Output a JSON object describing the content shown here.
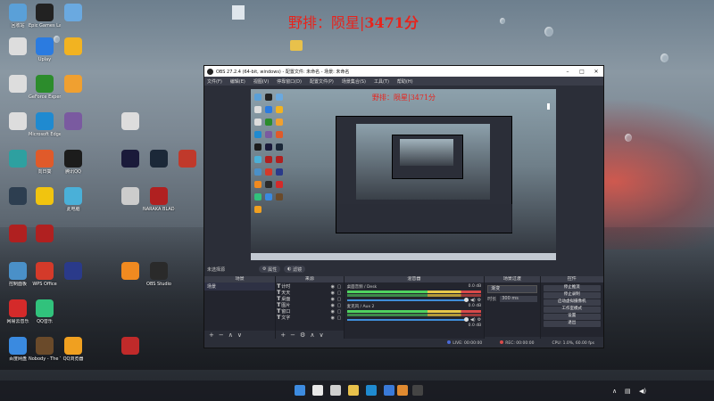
{
  "wallpaper": {
    "accent": "#e05446"
  },
  "streamer_title": {
    "prefix": "野排：陨星|",
    "score": "3471分"
  },
  "desktop_icons": [
    {
      "label": "回收站",
      "icon": "recycle-bin-icon",
      "color": "#5aa0d8"
    },
    {
      "label": "Epic Games Launcher",
      "icon": "epic-games-icon",
      "color": "#222222"
    },
    {
      "label": "",
      "icon": "cloud-icon",
      "color": "#6aa9e0"
    },
    {
      "label": "",
      "icon": "file-icon",
      "color": "#dddddd"
    },
    {
      "label": "Uplay",
      "icon": "uplay-icon",
      "color": "#2b7be0"
    },
    {
      "label": "",
      "icon": "gamepad-icon",
      "color": "#f2b321"
    },
    {
      "label": "",
      "icon": "file-icon",
      "color": "#dddddd"
    },
    {
      "label": "GeForce Experience",
      "icon": "nvidia-icon",
      "color": "#2c8c2c"
    },
    {
      "label": "",
      "icon": "cloud-icon",
      "color": "#f0a030"
    },
    {
      "label": "",
      "icon": "file-icon",
      "color": "#dddddd"
    },
    {
      "label": "Microsoft Edge",
      "icon": "edge-icon",
      "color": "#1f8ad0"
    },
    {
      "label": "",
      "icon": "game-icon",
      "color": "#7a5aa0"
    },
    {
      "label": "",
      "icon": "file-icon",
      "color": "#dddddd"
    },
    {
      "label": "",
      "icon": "app-icon",
      "color": "#2ea0a0"
    },
    {
      "label": "向日葵",
      "icon": "sunflower-icon",
      "color": "#e05a2a"
    },
    {
      "label": "腾讯QQ",
      "icon": "qq-icon",
      "color": "#1c1c1c"
    },
    {
      "label": "",
      "icon": "premiere-icon",
      "color": "#1a1a3a"
    },
    {
      "label": "",
      "icon": "steam-icon",
      "color": "#1b2838"
    },
    {
      "label": "",
      "icon": "game-icon",
      "color": "#c0392b"
    },
    {
      "label": "",
      "icon": "game-icon",
      "color": "#2d3e50"
    },
    {
      "label": "",
      "icon": "game-icon",
      "color": "#f1c40f"
    },
    {
      "label": "此电脑",
      "icon": "computer-icon",
      "color": "#4ab0d8"
    },
    {
      "label": "",
      "icon": "app-icon",
      "color": "#cccccc"
    },
    {
      "label": "NARAKA BLADEPOINT",
      "icon": "naraka-icon",
      "color": "#b02020"
    },
    {
      "label": "",
      "icon": "game-icon",
      "color": "#b02020"
    },
    {
      "label": "",
      "icon": "game-icon",
      "color": "#b02020"
    },
    {
      "label": "控制面板",
      "icon": "control-panel-icon",
      "color": "#4a90c8"
    },
    {
      "label": "WPS Office",
      "icon": "wps-icon",
      "color": "#d43a2a"
    },
    {
      "label": "",
      "icon": "app-icon",
      "color": "#2a3a8a"
    },
    {
      "label": "",
      "icon": "app-icon",
      "color": "#f08a20"
    },
    {
      "label": "OBS Studio",
      "icon": "obs-icon",
      "color": "#2a2a2a"
    },
    {
      "label": "网易云音乐",
      "icon": "netease-music-icon",
      "color": "#d42a2a"
    },
    {
      "label": "QQ音乐",
      "icon": "qq-music-icon",
      "color": "#31c27c"
    },
    {
      "label": "百度网盘",
      "icon": "baidu-netdisk-icon",
      "color": "#3a8ae0"
    },
    {
      "label": "Nobody - The Turnaround",
      "icon": "game-icon",
      "color": "#6a4a2a"
    },
    {
      "label": "QQ浏览器",
      "icon": "qq-browser-icon",
      "color": "#f0a020"
    },
    {
      "label": "",
      "icon": "app-icon",
      "color": "#c02a2a"
    }
  ],
  "obs": {
    "title": "OBS 27.2.4 (64-bit, windows) - 配置文件: 未命名 - 场景: 未命名",
    "menu": [
      "文件(F)",
      "编辑(E)",
      "视图(V)",
      "停靠窗口(D)",
      "配置文件(P)",
      "场景集合(S)",
      "工具(T)",
      "帮助(H)"
    ],
    "preview_title": "野排：陨星|3471分",
    "scene_bar": {
      "label": "未选择源",
      "properties": "属性",
      "filters": "滤镜"
    },
    "scenes": {
      "header": "场景",
      "items": [
        "场景"
      ]
    },
    "sources": {
      "header": "来源",
      "items": [
        "计时",
        "天天",
        "桌面",
        "图片",
        "窗口",
        "文字"
      ]
    },
    "mixer": {
      "header": "混音器",
      "channels": [
        {
          "name": "桌面音频 / Desk",
          "db": "0.0 dB"
        },
        {
          "name": "麦克风 / Aux 2",
          "db": "0.0 dB"
        },
        {
          "name": "",
          "db": "0.0 dB"
        }
      ]
    },
    "transitions": {
      "header": "场景过渡",
      "selected": "渐变",
      "duration_label": "时长",
      "duration": "300 ms"
    },
    "controls": {
      "header": "控件",
      "buttons": [
        "停止推流",
        "停止录制",
        "启动虚拟摄像机",
        "工作室模式",
        "设置",
        "退出"
      ]
    },
    "status": {
      "live": "LIVE: 00:00:00",
      "rec": "REC: 00:00:00",
      "cpu": "CPU: 1.0%, 60.00 fps"
    }
  },
  "taskbar": {
    "clock": "",
    "icons": [
      "start-icon",
      "search-icon",
      "task-view-icon",
      "explorer-icon",
      "edge-icon",
      "store-icon",
      "app-icon",
      "obs-icon"
    ]
  }
}
